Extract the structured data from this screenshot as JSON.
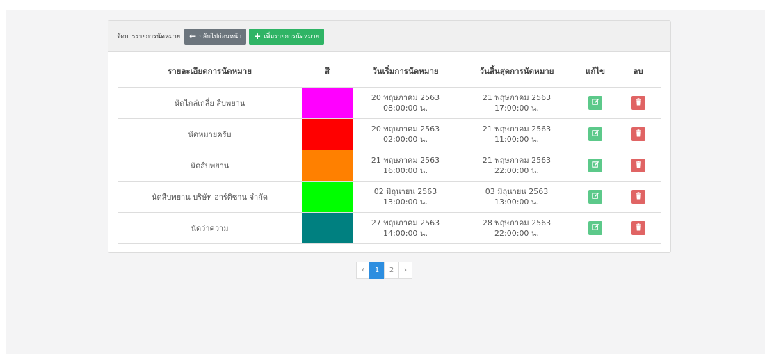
{
  "header": {
    "title": "จัดการรายการนัดหมาย",
    "back_label": "กลับไปก่อนหน้า",
    "add_label": "เพิ่มรายการนัดหมาย"
  },
  "table": {
    "columns": [
      "รายละเอียดการนัดหมาย",
      "สี",
      "วันเริ่มการนัดหมาย",
      "วันสิ้นสุดการนัดหมาย",
      "แก้ไข",
      "ลบ"
    ],
    "rows": [
      {
        "detail": "นัดไกล่เกลี่ย สืบพยาน",
        "color": "#ff00ff",
        "start_date": "20 พฤษภาคม 2563",
        "start_time": "08:00:00 น.",
        "end_date": "21 พฤษภาคม 2563",
        "end_time": "17:00:00 น."
      },
      {
        "detail": "นัดหมายครับ",
        "color": "#ff0000",
        "start_date": "20 พฤษภาคม 2563",
        "start_time": "02:00:00 น.",
        "end_date": "21 พฤษภาคม 2563",
        "end_time": "11:00:00 น."
      },
      {
        "detail": "นัดสืบพยาน",
        "color": "#ff8000",
        "start_date": "21 พฤษภาคม 2563",
        "start_time": "16:00:00 น.",
        "end_date": "21 พฤษภาคม 2563",
        "end_time": "22:00:00 น."
      },
      {
        "detail": "นัดสืบพยาน บริษัท อาร์ติซาน จำกัด",
        "color": "#00ff00",
        "start_date": "02 มิถุนายน 2563",
        "start_time": "13:00:00 น.",
        "end_date": "03 มิถุนายน 2563",
        "end_time": "13:00:00 น."
      },
      {
        "detail": "นัดว่าความ",
        "color": "#008080",
        "start_date": "27 พฤษภาคม 2563",
        "start_time": "14:00:00 น.",
        "end_date": "28 พฤษภาคม 2563",
        "end_time": "22:00:00 น."
      }
    ]
  },
  "pagination": {
    "prev": "‹",
    "pages": [
      "1",
      "2"
    ],
    "current": "1",
    "next": "›"
  },
  "colors": {
    "edit_button": "#5cc98a",
    "delete_button": "#e06464",
    "add_button": "#2fb465",
    "back_button": "#6c757d",
    "active_page": "#2d8ee0"
  },
  "icons": {
    "back": "arrow-left-icon",
    "add": "plus-icon",
    "edit": "edit-icon",
    "delete": "trash-icon"
  }
}
